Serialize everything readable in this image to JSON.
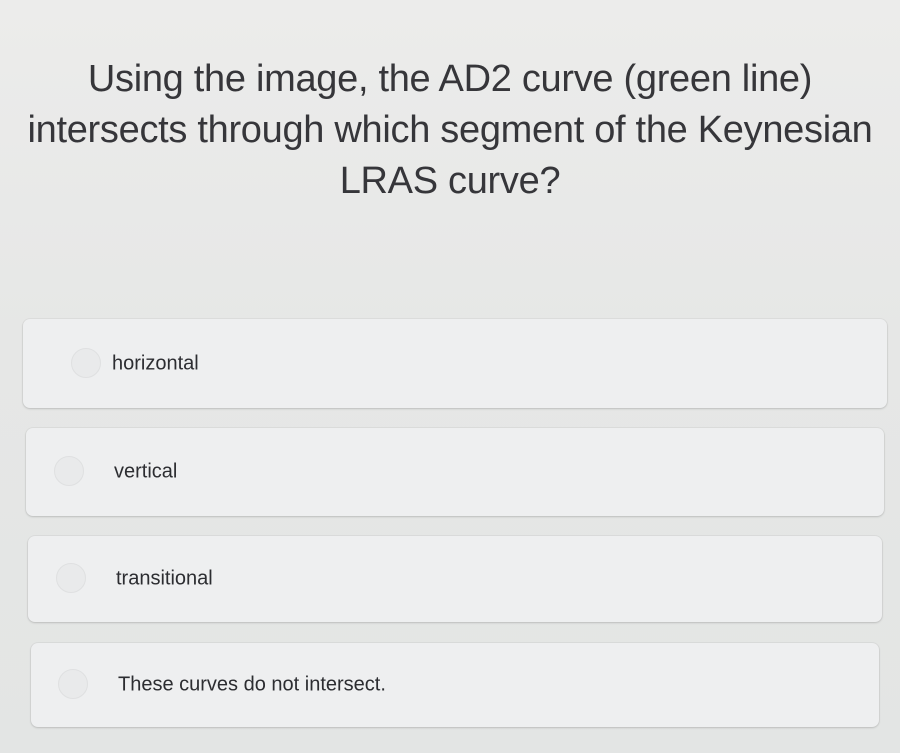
{
  "question": {
    "text": "Using the image, the AD2 curve (green line) intersects through which segment of the Keynesian LRAS curve?"
  },
  "options": [
    {
      "label": "horizontal"
    },
    {
      "label": "vertical"
    },
    {
      "label": "transitional"
    },
    {
      "label": "These curves do not intersect."
    }
  ]
}
